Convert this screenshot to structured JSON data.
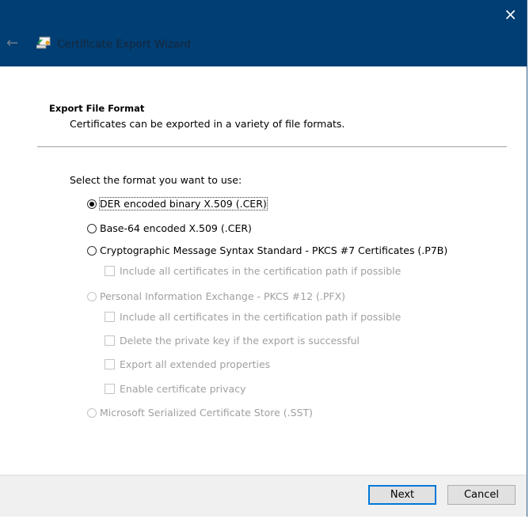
{
  "window": {
    "title": "Certificate Export Wizard"
  },
  "page": {
    "heading": "Export File Format",
    "subheading": "Certificates can be exported in a variety of file formats.",
    "prompt": "Select the format you want to use:"
  },
  "options": [
    {
      "label": "DER encoded binary X.509 (.CER)",
      "selected": true,
      "enabled": true
    },
    {
      "label": "Base-64 encoded X.509 (.CER)",
      "selected": false,
      "enabled": true
    },
    {
      "label": "Cryptographic Message Syntax Standard - PKCS #7 Certificates (.P7B)",
      "selected": false,
      "enabled": true
    },
    {
      "label": "Personal Information Exchange - PKCS #12 (.PFX)",
      "selected": false,
      "enabled": false
    },
    {
      "label": "Microsoft Serialized Certificate Store (.SST)",
      "selected": false,
      "enabled": false
    }
  ],
  "checkboxes": {
    "p7b_include": "Include all certificates in the certification path if possible",
    "pfx_include": "Include all certificates in the certification path if possible",
    "pfx_delete_key": "Delete the private key if the export is successful",
    "pfx_export_ext": "Export all extended properties",
    "pfx_privacy": "Enable certificate privacy"
  },
  "buttons": {
    "next": "Next",
    "cancel": "Cancel"
  },
  "icons": {
    "close": "×",
    "back": "←"
  }
}
